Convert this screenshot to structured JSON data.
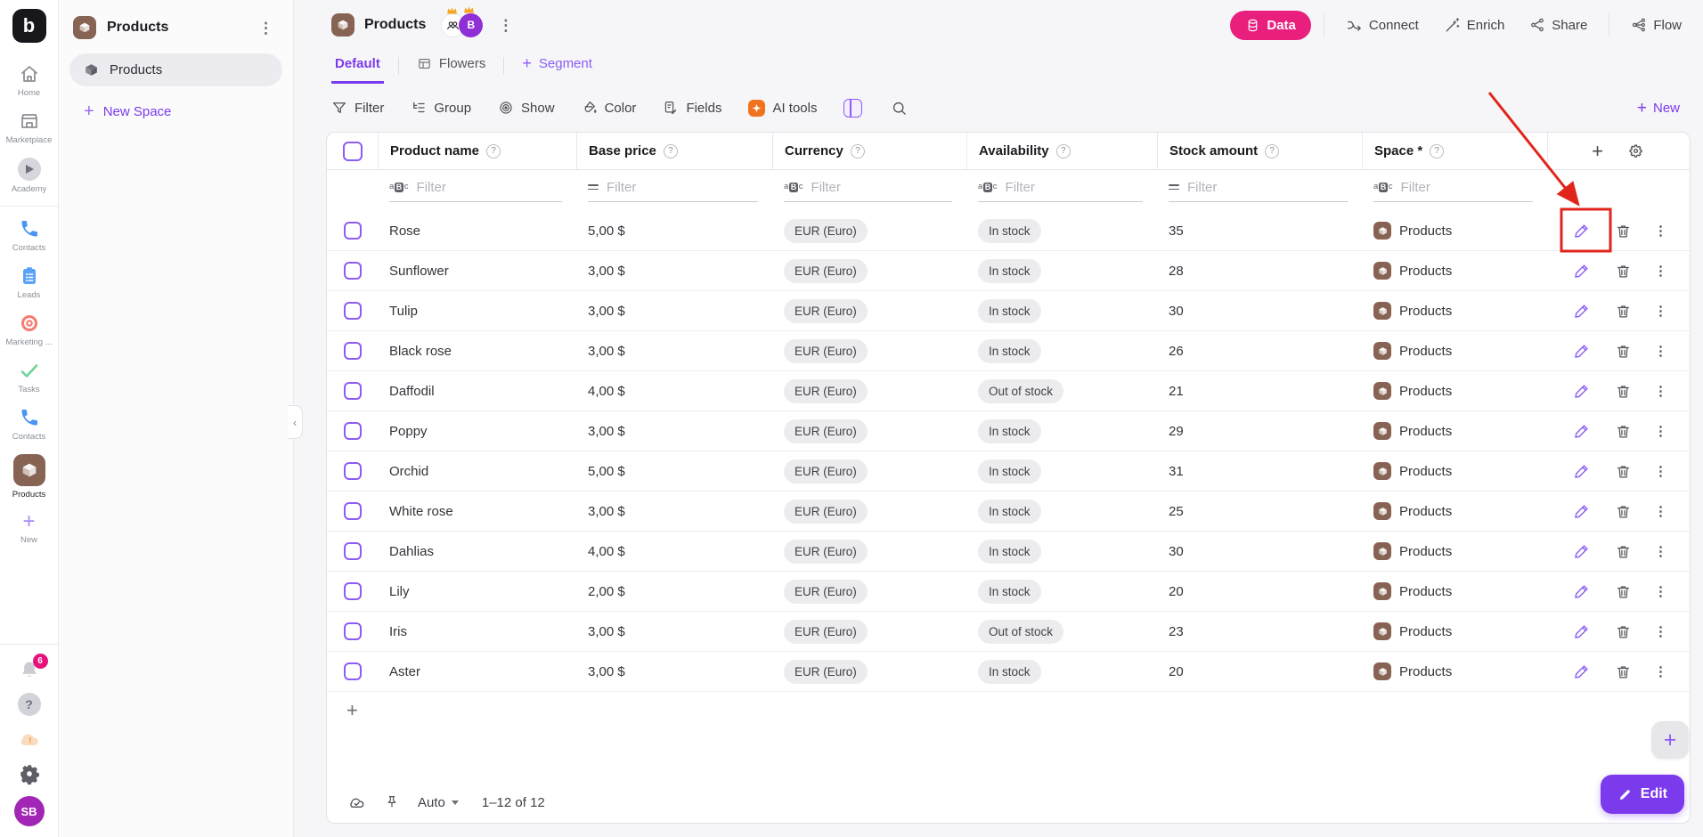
{
  "left_rail": {
    "logo_letter": "b",
    "items": [
      {
        "label": "Home",
        "icon": "home-icon"
      },
      {
        "label": "Marketplace",
        "icon": "storefront-icon"
      },
      {
        "label": "Academy",
        "icon": "play-icon"
      },
      {
        "label": "Contacts",
        "icon": "phone-icon"
      },
      {
        "label": "Leads",
        "icon": "clipboard-icon"
      },
      {
        "label": "Marketing ...",
        "icon": "target-icon"
      },
      {
        "label": "Tasks",
        "icon": "check-icon"
      },
      {
        "label": "Contacts",
        "icon": "phone-icon"
      },
      {
        "label": "Products",
        "icon": "box-icon"
      },
      {
        "label": "New",
        "icon": "plus-icon"
      }
    ],
    "notification_count": "6",
    "avatar_initials": "SB"
  },
  "spaces": {
    "title": "Products",
    "item_label": "Products",
    "new_space": "New Space"
  },
  "header": {
    "title": "Products",
    "member_badge": "B",
    "data_button": "Data",
    "connect": "Connect",
    "enrich": "Enrich",
    "share": "Share",
    "flow": "Flow"
  },
  "tabs": {
    "default": "Default",
    "flowers": "Flowers",
    "segment": "Segment"
  },
  "toolbar": {
    "filter": "Filter",
    "group": "Group",
    "show": "Show",
    "color": "Color",
    "fields": "Fields",
    "ai_tools": "AI tools",
    "new": "New"
  },
  "table": {
    "columns": [
      "Product name",
      "Base price",
      "Currency",
      "Availability",
      "Stock amount",
      "Space *"
    ],
    "filter_placeholder": "Filter",
    "rows": [
      {
        "name": "Rose",
        "price": "5,00 $",
        "currency": "EUR (Euro)",
        "availability": "In stock",
        "stock": "35",
        "space": "Products"
      },
      {
        "name": "Sunflower",
        "price": "3,00 $",
        "currency": "EUR (Euro)",
        "availability": "In stock",
        "stock": "28",
        "space": "Products"
      },
      {
        "name": "Tulip",
        "price": "3,00 $",
        "currency": "EUR (Euro)",
        "availability": "In stock",
        "stock": "30",
        "space": "Products"
      },
      {
        "name": "Black rose",
        "price": "3,00 $",
        "currency": "EUR (Euro)",
        "availability": "In stock",
        "stock": "26",
        "space": "Products"
      },
      {
        "name": "Daffodil",
        "price": "4,00 $",
        "currency": "EUR (Euro)",
        "availability": "Out of stock",
        "stock": "21",
        "space": "Products"
      },
      {
        "name": "Poppy",
        "price": "3,00 $",
        "currency": "EUR (Euro)",
        "availability": "In stock",
        "stock": "29",
        "space": "Products"
      },
      {
        "name": "Orchid",
        "price": "5,00 $",
        "currency": "EUR (Euro)",
        "availability": "In stock",
        "stock": "31",
        "space": "Products"
      },
      {
        "name": "White rose",
        "price": "3,00 $",
        "currency": "EUR (Euro)",
        "availability": "In stock",
        "stock": "25",
        "space": "Products"
      },
      {
        "name": "Dahlias",
        "price": "4,00 $",
        "currency": "EUR (Euro)",
        "availability": "In stock",
        "stock": "30",
        "space": "Products"
      },
      {
        "name": "Lily",
        "price": "2,00 $",
        "currency": "EUR (Euro)",
        "availability": "In stock",
        "stock": "20",
        "space": "Products"
      },
      {
        "name": "Iris",
        "price": "3,00 $",
        "currency": "EUR (Euro)",
        "availability": "Out of stock",
        "stock": "23",
        "space": "Products"
      },
      {
        "name": "Aster",
        "price": "3,00 $",
        "currency": "EUR (Euro)",
        "availability": "In stock",
        "stock": "20",
        "space": "Products"
      }
    ]
  },
  "footer": {
    "mode": "Auto",
    "range": "1–12 of 12",
    "edit": "Edit"
  },
  "colors": {
    "accent": "#7c3aed",
    "pink": "#e91f7e",
    "brown": "#876353",
    "pill_gray": "#ececef"
  }
}
